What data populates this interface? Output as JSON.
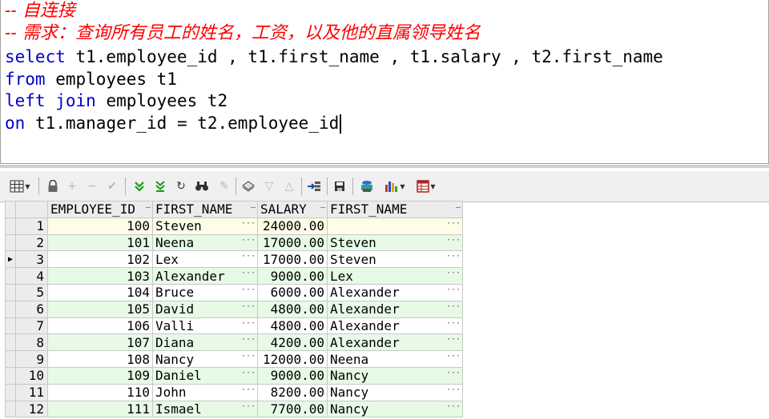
{
  "editor": {
    "comment1": "-- 自连接",
    "comment2": "-- 需求：查询所有员工的姓名，工资，以及他的直属领导姓名",
    "line1_kw": "select",
    "line1_rest": " t1.employee_id , t1.first_name , t1.salary , t2.first_name",
    "line2_kw": "from",
    "line2_rest": " employees t1",
    "line3_kw": "left join",
    "line3_rest": " employees t2",
    "line4_kw": "on",
    "line4_rest": " t1.manager_id = t2.employee_id"
  },
  "toolbar": {
    "icons": [
      "grid-view-icon",
      "lock-icon",
      "add-record-icon",
      "delete-record-icon",
      "post-icon",
      "fetch-next-icon",
      "fetch-last-icon",
      "refresh-icon",
      "find-icon",
      "clear-icon",
      "query-by-example-icon",
      "filter-down-icon",
      "filter-up-icon",
      "export-icon",
      "save-icon",
      "print-icon",
      "chart-icon",
      "table-icon"
    ]
  },
  "grid": {
    "columns": [
      "EMPLOYEE_ID",
      "FIRST_NAME",
      "SALARY",
      "FIRST_NAME"
    ],
    "rows": [
      {
        "n": "1",
        "id": "100",
        "name": "Steven",
        "salary": "24000.00",
        "mgr": ""
      },
      {
        "n": "2",
        "id": "101",
        "name": "Neena",
        "salary": "17000.00",
        "mgr": "Steven"
      },
      {
        "n": "3",
        "id": "102",
        "name": "Lex",
        "salary": "17000.00",
        "mgr": "Steven"
      },
      {
        "n": "4",
        "id": "103",
        "name": "Alexander",
        "salary": "9000.00",
        "mgr": "Lex"
      },
      {
        "n": "5",
        "id": "104",
        "name": "Bruce",
        "salary": "6000.00",
        "mgr": "Alexander"
      },
      {
        "n": "6",
        "id": "105",
        "name": "David",
        "salary": "4800.00",
        "mgr": "Alexander"
      },
      {
        "n": "7",
        "id": "106",
        "name": "Valli",
        "salary": "4800.00",
        "mgr": "Alexander"
      },
      {
        "n": "8",
        "id": "107",
        "name": "Diana",
        "salary": "4200.00",
        "mgr": "Alexander"
      },
      {
        "n": "9",
        "id": "108",
        "name": "Nancy",
        "salary": "12000.00",
        "mgr": "Neena"
      },
      {
        "n": "10",
        "id": "109",
        "name": "Daniel",
        "salary": "9000.00",
        "mgr": "Nancy"
      },
      {
        "n": "11",
        "id": "110",
        "name": "John",
        "salary": "8200.00",
        "mgr": "Nancy"
      },
      {
        "n": "12",
        "id": "111",
        "name": "Ismael",
        "salary": "7700.00",
        "mgr": "Nancy"
      }
    ]
  }
}
